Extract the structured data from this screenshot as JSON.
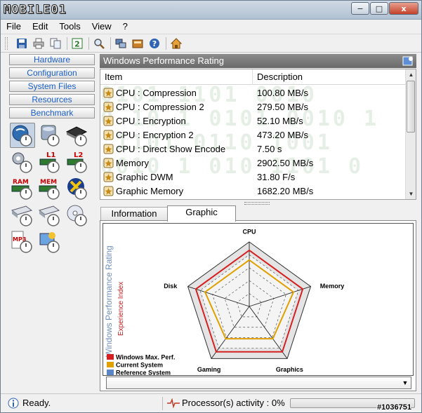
{
  "app": {
    "logo_text": "MOBILE01"
  },
  "window_controls": {
    "minimize": "−",
    "maximize": "□",
    "close": "x"
  },
  "menu": [
    "File",
    "Edit",
    "Tools",
    "View",
    "?"
  ],
  "toolbar_icons": [
    "save-icon",
    "print-icon",
    "copy-icon",
    "refresh-icon",
    "search-icon",
    "network-icon",
    "report-icon",
    "help-icon",
    "home-icon"
  ],
  "sidebar": {
    "nav": [
      "Hardware",
      "Configuration",
      "System Files",
      "Resources",
      "Benchmark"
    ],
    "tools": [
      {
        "icon": "windows-rating-icon"
      },
      {
        "icon": "cpu-benchmark-icon"
      },
      {
        "icon": "chip-benchmark-icon"
      },
      {
        "icon": "gear-benchmark-icon"
      },
      {
        "icon": "cache-l1-icon",
        "label": "L1"
      },
      {
        "icon": "cache-l2-icon",
        "label": "L2"
      },
      {
        "icon": "ram-benchmark-icon",
        "label": "RAM"
      },
      {
        "icon": "memory-benchmark-icon",
        "label": "MEM"
      },
      {
        "icon": "directx-benchmark-icon"
      },
      {
        "icon": "drive-benchmark-icon"
      },
      {
        "icon": "drive-benchmark-2-icon"
      },
      {
        "icon": "cd-benchmark-icon"
      },
      {
        "icon": "mp3-benchmark-icon",
        "label": "MP3"
      },
      {
        "icon": "graphics-benchmark-icon"
      }
    ]
  },
  "panel": {
    "title": "Windows Performance Rating",
    "columns": [
      "Item",
      "Description"
    ],
    "rows": [
      {
        "item": "CPU : Compression",
        "value": "100.80 MB/s"
      },
      {
        "item": "CPU : Compression 2",
        "value": "279.50 MB/s"
      },
      {
        "item": "CPU : Encryption",
        "value": "52.10 MB/s"
      },
      {
        "item": "CPU : Encryption 2",
        "value": "473.20 MB/s"
      },
      {
        "item": "CPU : Direct Show Encode",
        "value": "7.50 s"
      },
      {
        "item": "Memory",
        "value": "2902.50 MB/s"
      },
      {
        "item": "Graphic DWM",
        "value": "31.80 F/s"
      },
      {
        "item": "Graphic Memory",
        "value": "1682.20 MB/s"
      }
    ]
  },
  "tabs": {
    "items": [
      "Information",
      "Graphic"
    ],
    "active": "Graphic"
  },
  "chart_data": {
    "type": "radar",
    "axes": [
      "CPU",
      "Memory",
      "Graphics",
      "Gaming",
      "Disk"
    ],
    "rings": 4,
    "ylabel": "Windows Performance Rating",
    "ylabel2": "Experience Index",
    "legend": [
      {
        "name": "Windows Max. Perf.",
        "color": "#d42020"
      },
      {
        "name": "Current System",
        "color": "#e0a000"
      },
      {
        "name": "Reference System",
        "color": "#5b86c5"
      }
    ],
    "series": [
      {
        "name": "Windows Max. Perf.",
        "color": "#d42020",
        "values": [
          0.87,
          0.87,
          0.87,
          0.87,
          0.87
        ]
      },
      {
        "name": "Current System",
        "color": "#e0a000",
        "values": [
          0.72,
          0.72,
          0.62,
          0.62,
          0.72
        ]
      }
    ]
  },
  "status": {
    "ready": "Ready.",
    "processor": "Processor(s) activity : 0%",
    "id": "#1036751"
  }
}
